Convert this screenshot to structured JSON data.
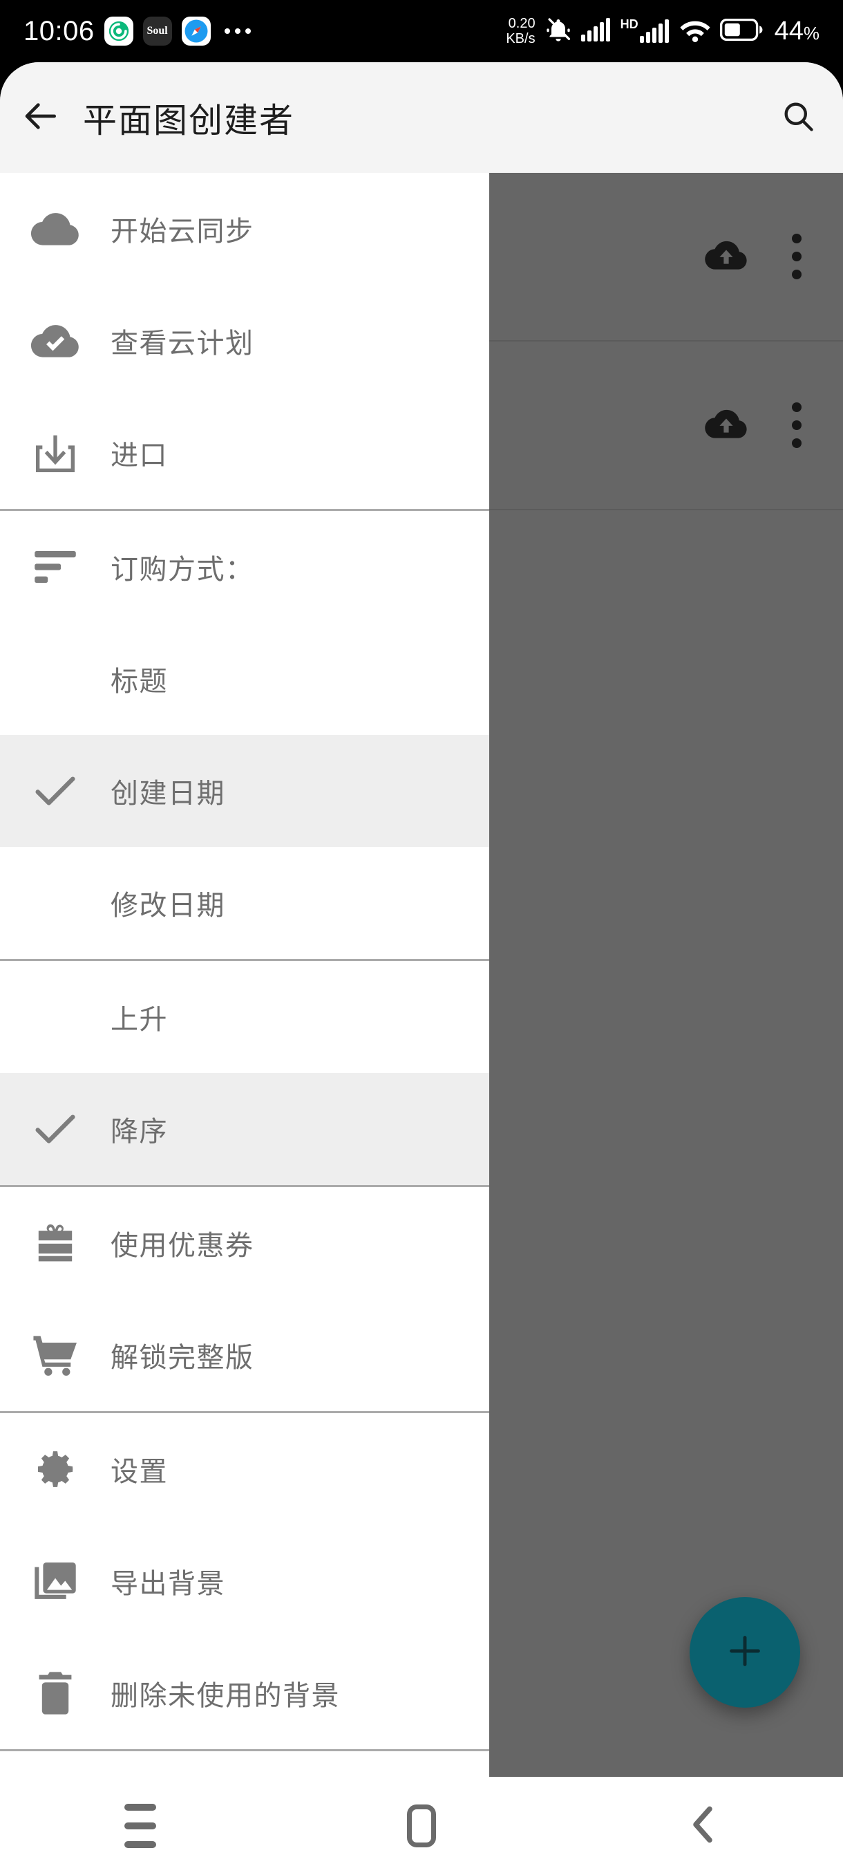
{
  "status_bar": {
    "clock": "10:06",
    "app_icons": [
      "camera-shutter-icon",
      "soul-app-icon",
      "compass-browser-icon"
    ],
    "overflow": "more-dots-icon",
    "data_rate_value": "0.20",
    "data_rate_unit": "KB/s",
    "icons": [
      "silent-bell-icon",
      "signal-bars-icon",
      "hd-label-icon",
      "signal-bars-2-icon",
      "wifi-icon",
      "battery-icon"
    ],
    "hd_label": "HD",
    "battery_percent": "44",
    "battery_percent_symbol": "%"
  },
  "app_bar": {
    "back_icon": "back-arrow-icon",
    "title": "平面图创建者",
    "search_icon": "search-icon"
  },
  "drawer": {
    "items": [
      {
        "label": "开始云同步",
        "icon": "cloud-icon",
        "selected": false,
        "indent": false,
        "divider_after": false
      },
      {
        "label": "查看云计划",
        "icon": "cloud-check-icon",
        "selected": false,
        "indent": false,
        "divider_after": false
      },
      {
        "label": "进口",
        "icon": "import-download-icon",
        "selected": false,
        "indent": false,
        "divider_after": true
      },
      {
        "label": "订购方式：",
        "icon": "sort-icon",
        "selected": false,
        "indent": false,
        "divider_after": false
      },
      {
        "label": "标题",
        "icon": "",
        "selected": false,
        "indent": true,
        "divider_after": false
      },
      {
        "label": "创建日期",
        "icon": "check-icon",
        "selected": true,
        "indent": true,
        "divider_after": false
      },
      {
        "label": "修改日期",
        "icon": "",
        "selected": false,
        "indent": true,
        "divider_after": true
      },
      {
        "label": "上升",
        "icon": "",
        "selected": false,
        "indent": true,
        "divider_after": false
      },
      {
        "label": "降序",
        "icon": "check-icon",
        "selected": true,
        "indent": true,
        "divider_after": false
      },
      {
        "label": "使用优惠券",
        "icon": "gift-card-icon",
        "selected": false,
        "indent": false,
        "divider_after": false
      },
      {
        "label": "解锁完整版",
        "icon": "shopping-cart-icon",
        "selected": false,
        "indent": false,
        "divider_after": true
      },
      {
        "label": "设置",
        "icon": "gear-icon",
        "selected": false,
        "indent": false,
        "divider_after": false
      },
      {
        "label": "导出背景",
        "icon": "image-export-icon",
        "selected": false,
        "indent": false,
        "divider_after": false
      },
      {
        "label": "删除未使用的背景",
        "icon": "trash-icon",
        "selected": false,
        "indent": false,
        "divider_after": true
      }
    ]
  },
  "background_list": {
    "rows": [
      {
        "cloud_icon": "cloud-upload-icon",
        "menu_icon": "kebab-menu-icon"
      },
      {
        "cloud_icon": "cloud-upload-icon",
        "menu_icon": "kebab-menu-icon"
      }
    ]
  },
  "fab": {
    "icon": "plus-icon",
    "color": "#0a616f"
  },
  "nav_bar": {
    "recents_icon": "menu-lines-icon",
    "home_icon": "home-square-icon",
    "back_icon": "chevron-left-icon"
  },
  "colors": {
    "accent": "#0a616f",
    "appbar_bg": "#f4f4f4",
    "drawer_selected": "#eeeeee",
    "divider": "#aaaaaa",
    "icon_gray": "#7d7d7d",
    "text_gray": "#6e6e6e",
    "scrim": "rgba(0,0,0,0.6)"
  }
}
